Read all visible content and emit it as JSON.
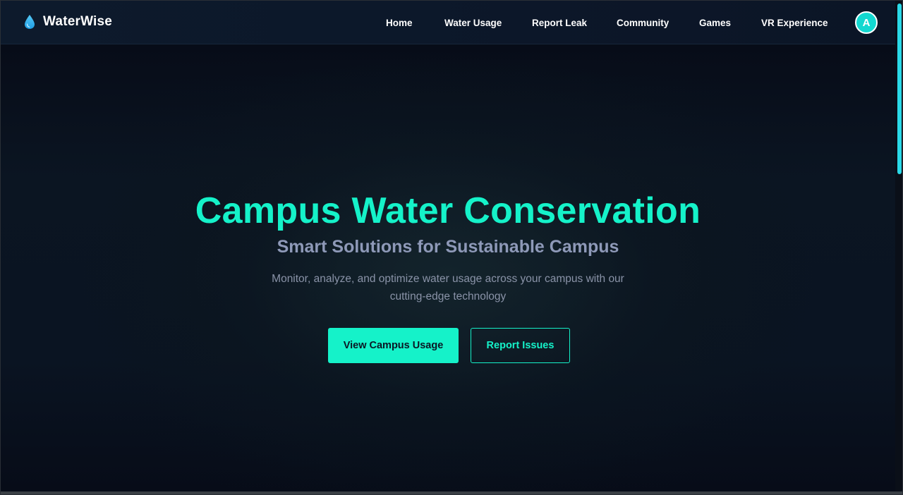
{
  "brand": {
    "name": "WaterWise",
    "icon": "water-drop-icon"
  },
  "nav": {
    "items": [
      {
        "label": "Home"
      },
      {
        "label": "Water Usage"
      },
      {
        "label": "Report Leak"
      },
      {
        "label": "Community"
      },
      {
        "label": "Games"
      },
      {
        "label": "VR Experience"
      }
    ],
    "avatar_initial": "A"
  },
  "hero": {
    "title": "Campus Water Conservation",
    "subtitle": "Smart Solutions for Sustainable Campus",
    "description": "Monitor, analyze, and optimize water usage across your campus with our cutting-edge technology",
    "primary_button": "View Campus Usage",
    "secondary_button": "Report Issues"
  },
  "colors": {
    "accent": "#15f2c9",
    "background": "#0a1220",
    "subtitle": "#8e99b8",
    "avatar": "#12d8d0"
  }
}
